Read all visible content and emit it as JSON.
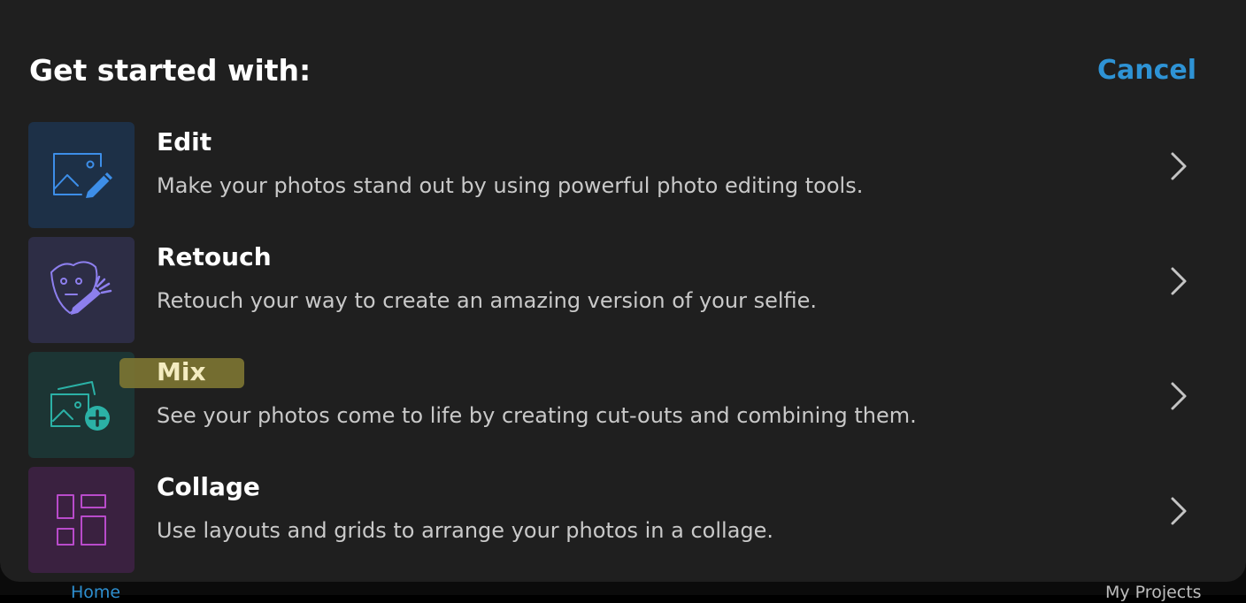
{
  "header": {
    "title": "Get started with:",
    "cancel_label": "Cancel"
  },
  "options": [
    {
      "title": "Edit",
      "description": "Make your photos stand out by using powerful photo editing tools.",
      "icon": "photo-edit-icon",
      "tile_color": "#1d3047",
      "icon_color": "#3d8ee8"
    },
    {
      "title": "Retouch",
      "description": "Retouch your way to create an amazing version of your selfie.",
      "icon": "face-retouch-icon",
      "tile_color": "#2d2d45",
      "icon_color": "#8d7fee"
    },
    {
      "title": "Mix",
      "description": "See your photos come to life by creating cut-outs and combining them.",
      "icon": "photo-mix-add-icon",
      "tile_color": "#1c3534",
      "icon_color": "#2bb1a6"
    },
    {
      "title": "Collage",
      "description": "Use layouts and grids to arrange your photos in a collage.",
      "icon": "collage-layout-icon",
      "tile_color": "#3a2140",
      "icon_color": "#b94bcb"
    }
  ],
  "bottom_nav": {
    "home_label": "Home",
    "projects_label": "My Projects"
  },
  "colors": {
    "accent": "#2e93d5",
    "sheet_background": "#1f1f1f",
    "highlight": "#7d7632"
  }
}
